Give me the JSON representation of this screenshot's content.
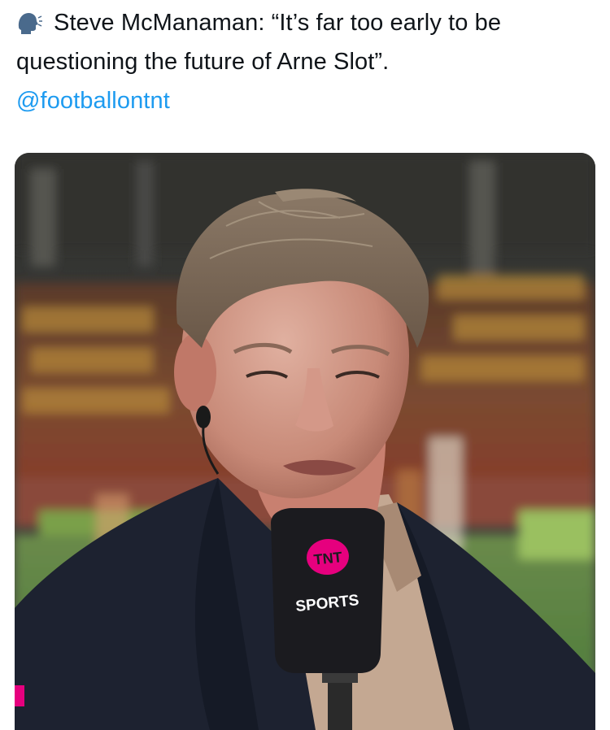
{
  "tweet": {
    "line1": "Steve McManaman: “It’s far too early to be",
    "line2": "questioning the future of Arne Slot”.",
    "handle": "@footballontnt",
    "icon": "speaking-head-icon"
  },
  "media": {
    "mic_logo_top": "TNT",
    "mic_logo_bottom": "SPORTS",
    "brand_pink": "#e6007e",
    "mic_color": "#1b1b1f"
  }
}
